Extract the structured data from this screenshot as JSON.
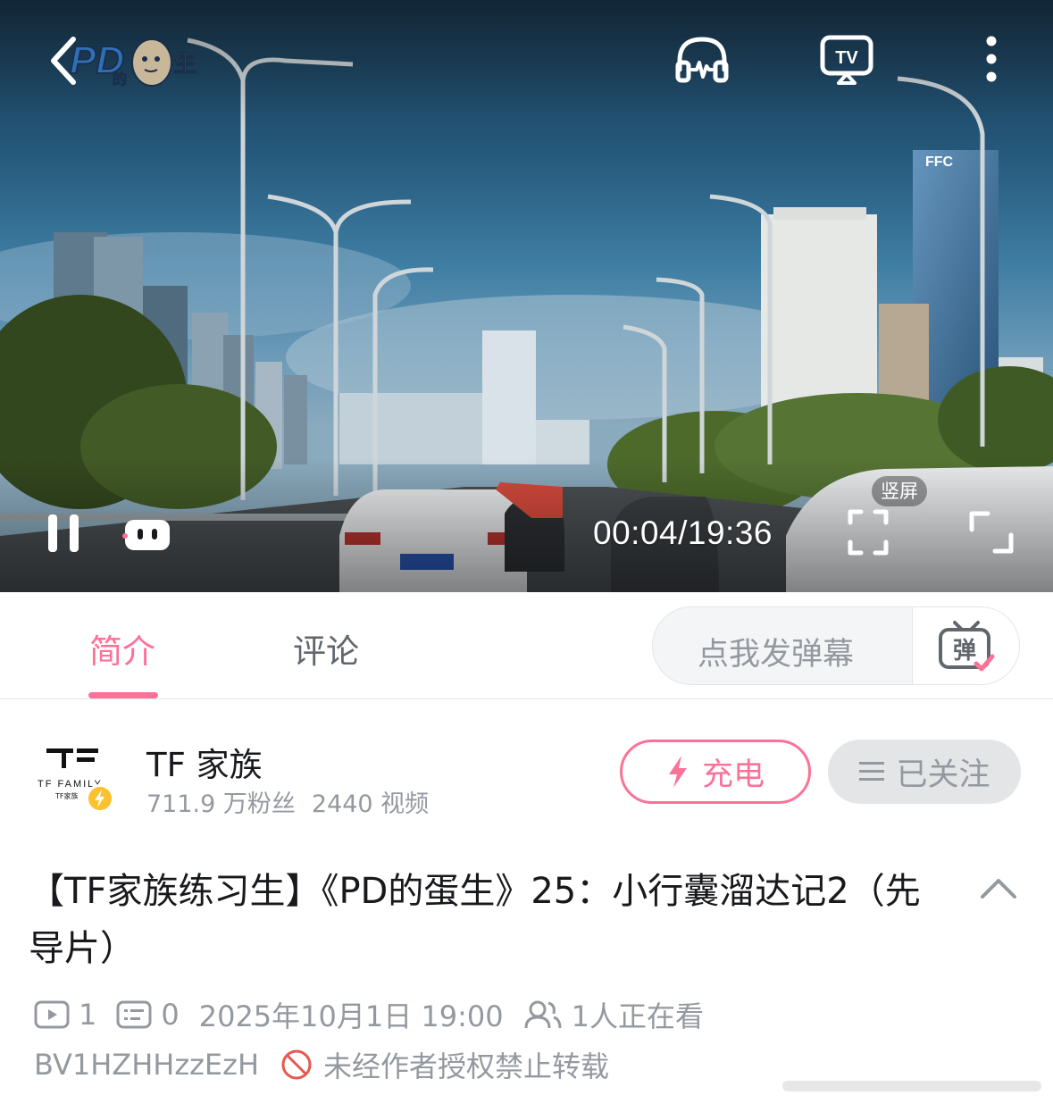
{
  "player": {
    "logo_text": "PD的蛋生",
    "time": "00:04/19:36",
    "vertical_label": "竖屏",
    "progress_fraction": 0.0034
  },
  "tabs": {
    "intro": "简介",
    "comment": "评论",
    "active": "intro",
    "danmaku_placeholder": "点我发弹幕",
    "danmaku_icon_char": "弹"
  },
  "uploader": {
    "name": "TF 家族",
    "avatar_text_main": "TF FAMILY",
    "avatar_text_sub": "TF家族",
    "fans": "711.9 万粉丝",
    "videos": "2440 视频",
    "charge_label": "充电",
    "follow_label": "已关注"
  },
  "video": {
    "title": "【TF家族练习生】《PD的蛋生》25：小行囊溜达记2（先导片）",
    "plays": "1",
    "danmaku_count": "0",
    "publish_time": "2025年10月1日 19:00",
    "watching": "1人正在看",
    "bvid": "BV1HZHHzzEzH",
    "reprint_notice": "未经作者授权禁止转载"
  },
  "colors": {
    "accent_pink": "#fb7299",
    "text_gray": "#9499a0",
    "verify_yellow": "#fbc12e"
  },
  "icons": {
    "back": "chevron-left-icon",
    "listen": "headphones-icon",
    "tv": "tv-cast-icon",
    "more": "more-vertical-icon",
    "pause": "pause-icon",
    "danmaku_toggle": "danmaku-tv-icon",
    "vertical": "vertical-screen-icon",
    "fullscreen": "fullscreen-icon",
    "charge": "lightning-icon",
    "follow": "menu-lines-icon",
    "collapse": "chevron-up-icon"
  }
}
